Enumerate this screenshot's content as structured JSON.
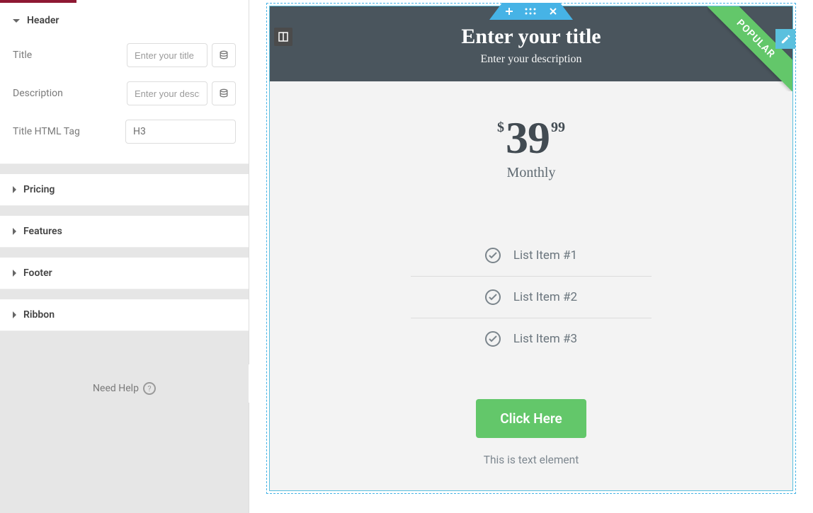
{
  "sidebar": {
    "sections": {
      "header": "Header",
      "pricing": "Pricing",
      "features": "Features",
      "footer": "Footer",
      "ribbon": "Ribbon"
    },
    "fields": {
      "title_label": "Title",
      "title_placeholder": "Enter your title",
      "desc_label": "Description",
      "desc_placeholder": "Enter your description",
      "tag_label": "Title HTML Tag",
      "tag_value": "H3"
    },
    "help": "Need Help"
  },
  "widget": {
    "title": "Enter your title",
    "desc": "Enter your description",
    "currency": "$",
    "amount": "39",
    "cents": "99",
    "period": "Monthly",
    "features": [
      "List Item #1",
      "List Item #2",
      "List Item #3"
    ],
    "button": "Click Here",
    "note": "This is text element",
    "ribbon": "POPULAR"
  }
}
